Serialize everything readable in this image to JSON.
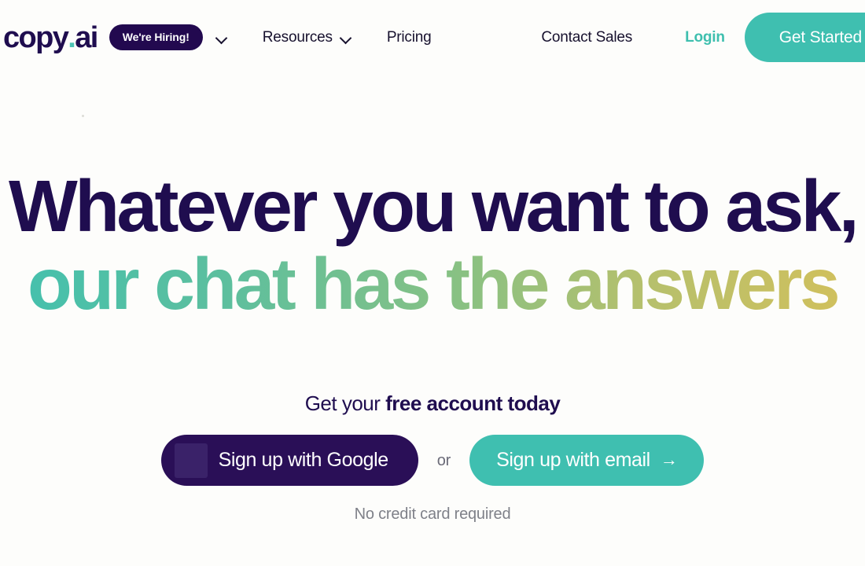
{
  "brand": {
    "navy": "#1f0d4f",
    "teal": "#3fbfb0",
    "gradient_start": "#43c0ae",
    "gradient_end": "#d3c05b",
    "google_button_bg": "#2a0f57",
    "page_bg": "#fdfdfb"
  },
  "header": {
    "logo": {
      "part1": "copy",
      "dot": ".",
      "part2": "ai"
    },
    "hiring_badge": "We're Hiring!",
    "caret_icon": "chevron-down-icon",
    "nav_items": [
      {
        "label": "Resources",
        "has_caret": true
      },
      {
        "label": "Pricing",
        "has_caret": false
      }
    ],
    "contact_sales": "Contact Sales",
    "login": "Login",
    "get_started": "Get Started"
  },
  "hero": {
    "headline_line_1": "Whatever you want to ask,",
    "headline_line_2": "our chat has the answers",
    "subhead_regular": "Get your ",
    "subhead_bold": "free account today",
    "google_button": "Sign up with Google",
    "google_icon": "google-logo-icon",
    "or_label": "or",
    "email_button": "Sign up with email",
    "email_arrow": "→",
    "footnote": "No credit card required"
  }
}
